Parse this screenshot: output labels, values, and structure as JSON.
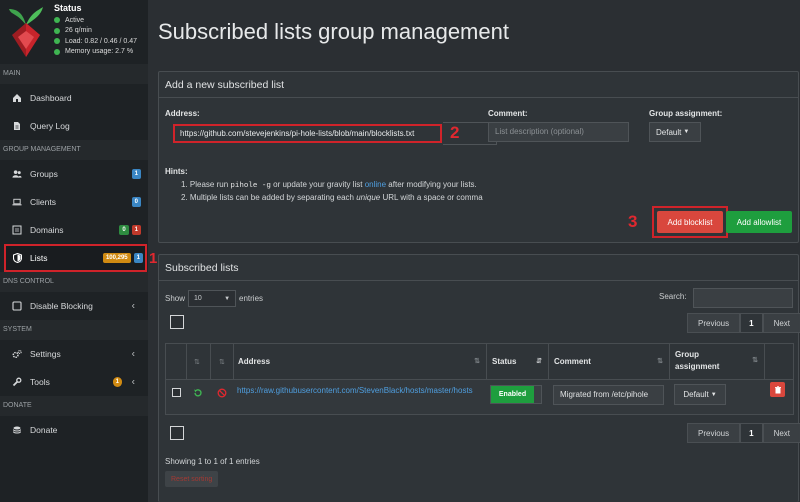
{
  "sidebar": {
    "status": {
      "title": "Status",
      "lines": [
        "Active",
        "26 q/min",
        "Load: 0.82 / 0.46 / 0.47",
        "Memory usage: 2.7 %"
      ]
    },
    "sections": {
      "main": "MAIN",
      "group": "GROUP MANAGEMENT",
      "dns": "DNS CONTROL",
      "system": "SYSTEM",
      "donate": "DONATE"
    },
    "items": {
      "dashboard": "Dashboard",
      "query_log": "Query Log",
      "groups": {
        "label": "Groups",
        "badge": "1"
      },
      "clients": {
        "label": "Clients",
        "badge": "0"
      },
      "domains": {
        "label": "Domains",
        "badge_a": "0",
        "badge_b": "1"
      },
      "lists": {
        "label": "Lists",
        "badge_a": "100,295",
        "badge_b": "1"
      },
      "disable_blocking": "Disable Blocking",
      "settings": "Settings",
      "tools": {
        "label": "Tools",
        "badge": "1"
      },
      "donate": "Donate"
    }
  },
  "annotations": [
    "1",
    "2",
    "3"
  ],
  "main": {
    "title": "Subscribed lists group management",
    "add_box": {
      "header": "Add a new subscribed list",
      "address_label": "Address:",
      "address_value": "https://github.com/stevejenkins/pi-hole-lists/blob/main/blocklists.txt",
      "comment_label": "Comment:",
      "comment_placeholder": "List description (optional)",
      "group_label": "Group assignment:",
      "group_value": "Default",
      "hints_title": "Hints:",
      "hint1_a": "1. Please run ",
      "hint1_code": "pihole -g",
      "hint1_b": " or update your gravity list ",
      "hint1_link": "online",
      "hint1_c": " after modifying your lists.",
      "hint2_a": "2. Multiple lists can be added by separating each ",
      "hint2_em": "unique",
      "hint2_b": " URL with a space or comma",
      "btn_blocklist": "Add blocklist",
      "btn_allowlist": "Add allowlist"
    },
    "list_box": {
      "header": "Subscribed lists",
      "show_label": "Show",
      "show_value": "10",
      "entries_label": "entries",
      "search_label": "Search:",
      "columns": [
        "Address",
        "Status",
        "Comment",
        "Group assignment"
      ],
      "row": {
        "address": "https://raw.githubusercontent.com/StevenBlack/hosts/master/hosts",
        "status": "Enabled",
        "comment": "Migrated from /etc/pihole",
        "group": "Default"
      },
      "pager": {
        "previous": "Previous",
        "page": "1",
        "next": "Next"
      },
      "info": "Showing 1 to 1 of 1 entries",
      "reset": "Reset sorting"
    }
  },
  "colors": {
    "accent_red": "#e0282f",
    "enabled_green": "#1e9e3e",
    "link_blue": "#4f9fe0"
  }
}
